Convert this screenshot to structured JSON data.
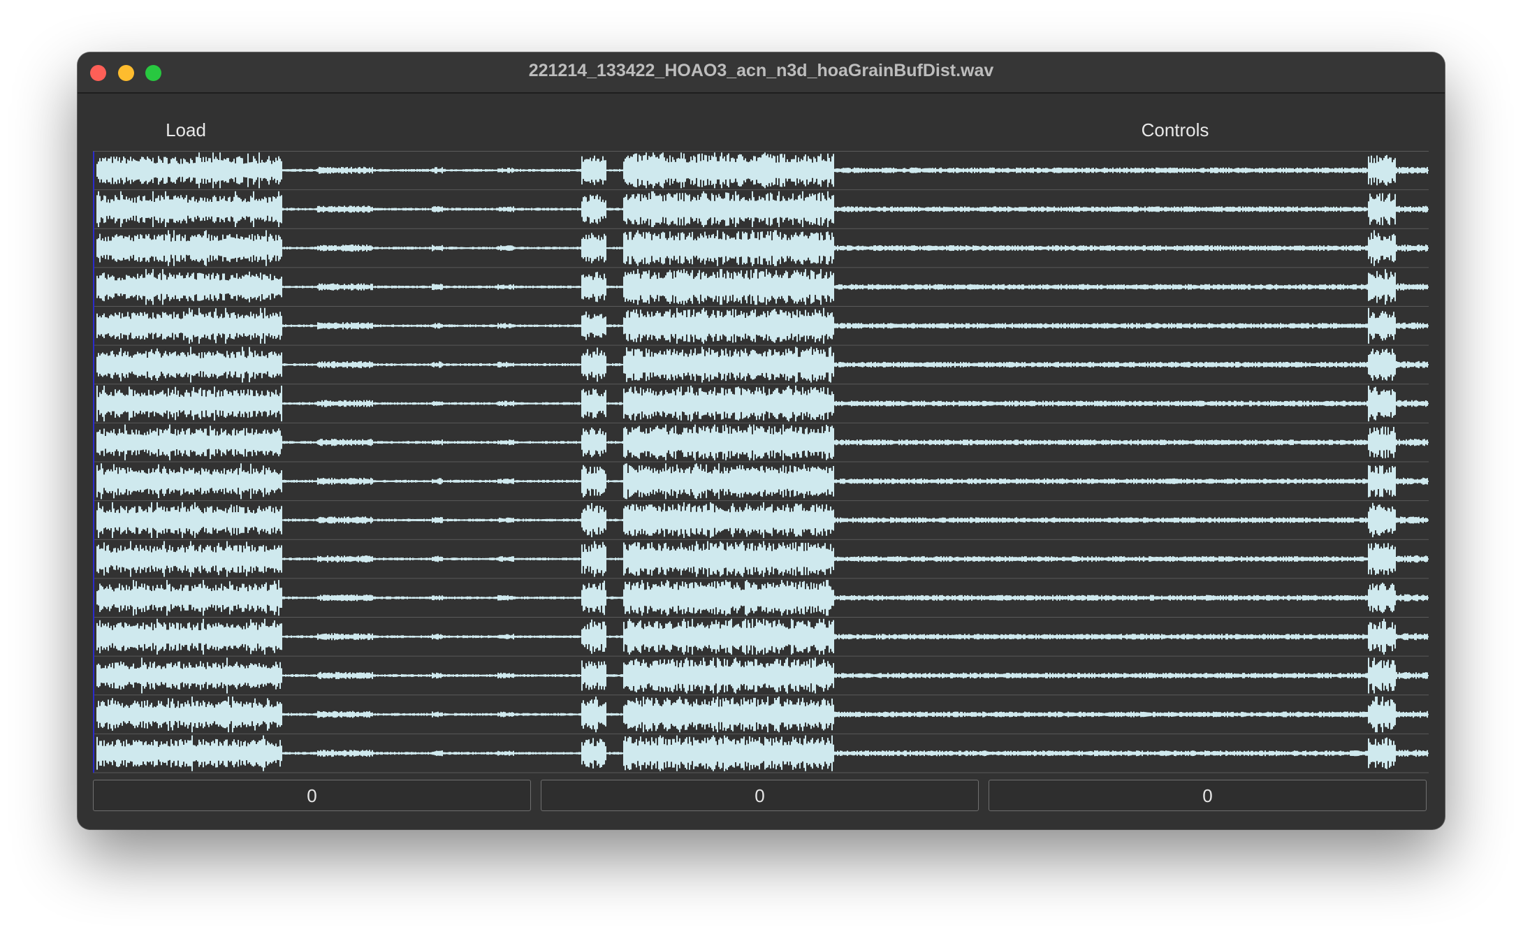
{
  "window": {
    "title": "221214_133422_HOAO3_acn_n3d_hoaGrainBufDist.wav",
    "controls": [
      "close",
      "minimize",
      "zoom"
    ]
  },
  "toolbar": {
    "load_label": "Load",
    "controls_label": "Controls"
  },
  "waveform": {
    "channel_count": 16,
    "colors": {
      "background": "#323232",
      "wave": "#cfe9ee",
      "separator": "#5a5a5a",
      "cursor": "#2a2acc"
    }
  },
  "number_boxes": [
    {
      "value": "0"
    },
    {
      "value": "0"
    },
    {
      "value": "0"
    }
  ]
}
